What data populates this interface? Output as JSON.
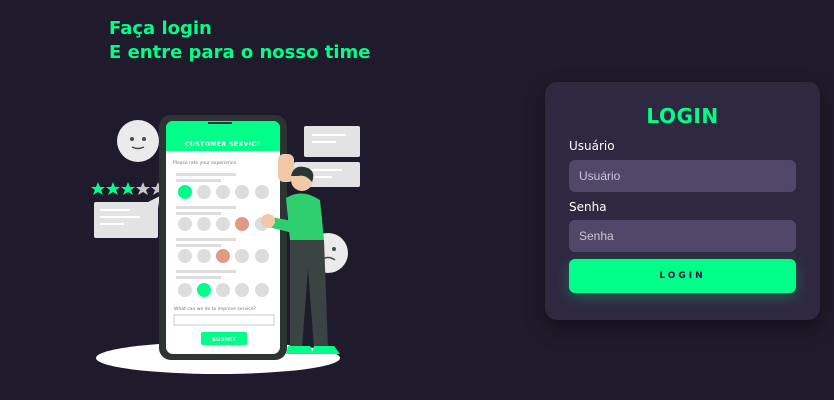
{
  "heading": {
    "line1": "Faça login",
    "line2": "E entre para o nosso time"
  },
  "illustration": {
    "phone_header": "CUSTOMER SERVICE",
    "rate_prompt": "Please rate your experience",
    "improve_prompt": "What can we do to improve service?",
    "submit_label": "SUBMIT",
    "stars_filled": 3,
    "stars_total": 5
  },
  "login": {
    "title": "LOGIN",
    "username_label": "Usuário",
    "username_placeholder": "Usuário",
    "password_label": "Senha",
    "password_placeholder": "Senha",
    "button_label": "LOGIN"
  },
  "colors": {
    "background": "#201b2c",
    "accent": "#00ff88",
    "card": "#2f2841",
    "input": "#514869"
  }
}
